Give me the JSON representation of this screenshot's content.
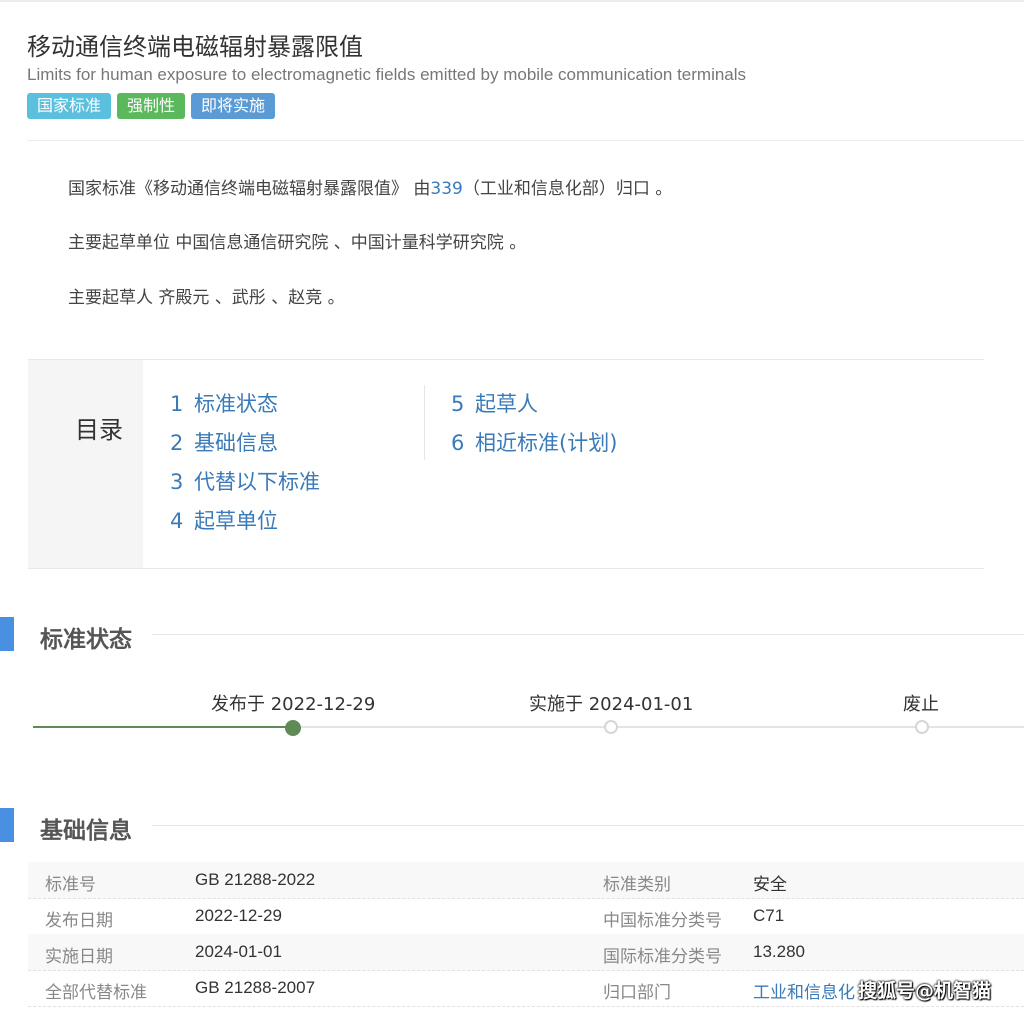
{
  "header": {
    "title": "移动通信终端电磁辐射暴露限值",
    "subtitle": "Limits for human exposure to electromagnetic fields emitted by mobile communication terminals",
    "tags": [
      "国家标准",
      "强制性",
      "即将实施"
    ]
  },
  "summary": {
    "line1_prefix": "国家标准《移动通信终端电磁辐射暴露限值》 由",
    "line1_link": "339",
    "line1_suffix": "（工业和信息化部）归口 。",
    "line2": "主要起草单位 中国信息通信研究院 、中国计量科学研究院 。",
    "line3": "主要起草人 齐殿元 、武彤 、赵竞 。"
  },
  "toc": {
    "label": "目录",
    "items": [
      {
        "num": "1",
        "label": "标准状态"
      },
      {
        "num": "2",
        "label": "基础信息"
      },
      {
        "num": "3",
        "label": "代替以下标准"
      },
      {
        "num": "4",
        "label": "起草单位"
      },
      {
        "num": "5",
        "label": "起草人"
      },
      {
        "num": "6",
        "label": "相近标准(计划)"
      }
    ]
  },
  "status": {
    "title": "标准状态",
    "progress": 0.265,
    "steps": [
      {
        "label": "发布于 2022-12-29",
        "state": "done"
      },
      {
        "label": "实施于 2024-01-01",
        "state": "pending"
      },
      {
        "label": "废止",
        "state": "pending"
      }
    ]
  },
  "basic": {
    "title": "基础信息",
    "rows": [
      {
        "l1": "标准号",
        "v1": "GB 21288-2022",
        "l2": "标准类别",
        "v2": "安全"
      },
      {
        "l1": "发布日期",
        "v1": "2022-12-29",
        "l2": "中国标准分类号",
        "v2": "C71"
      },
      {
        "l1": "实施日期",
        "v1": "2024-01-01",
        "l2": "国际标准分类号",
        "v2": "13.280"
      },
      {
        "l1": "全部代替标准",
        "v1": "GB 21288-2007",
        "l2": "归口部门",
        "v2": "工业和信息化"
      }
    ]
  },
  "watermark": "搜狐号@机智猫",
  "colors": {
    "accent": "#4a90e2",
    "link": "#3b7ab8",
    "timeline_done": "#5f8a56"
  }
}
